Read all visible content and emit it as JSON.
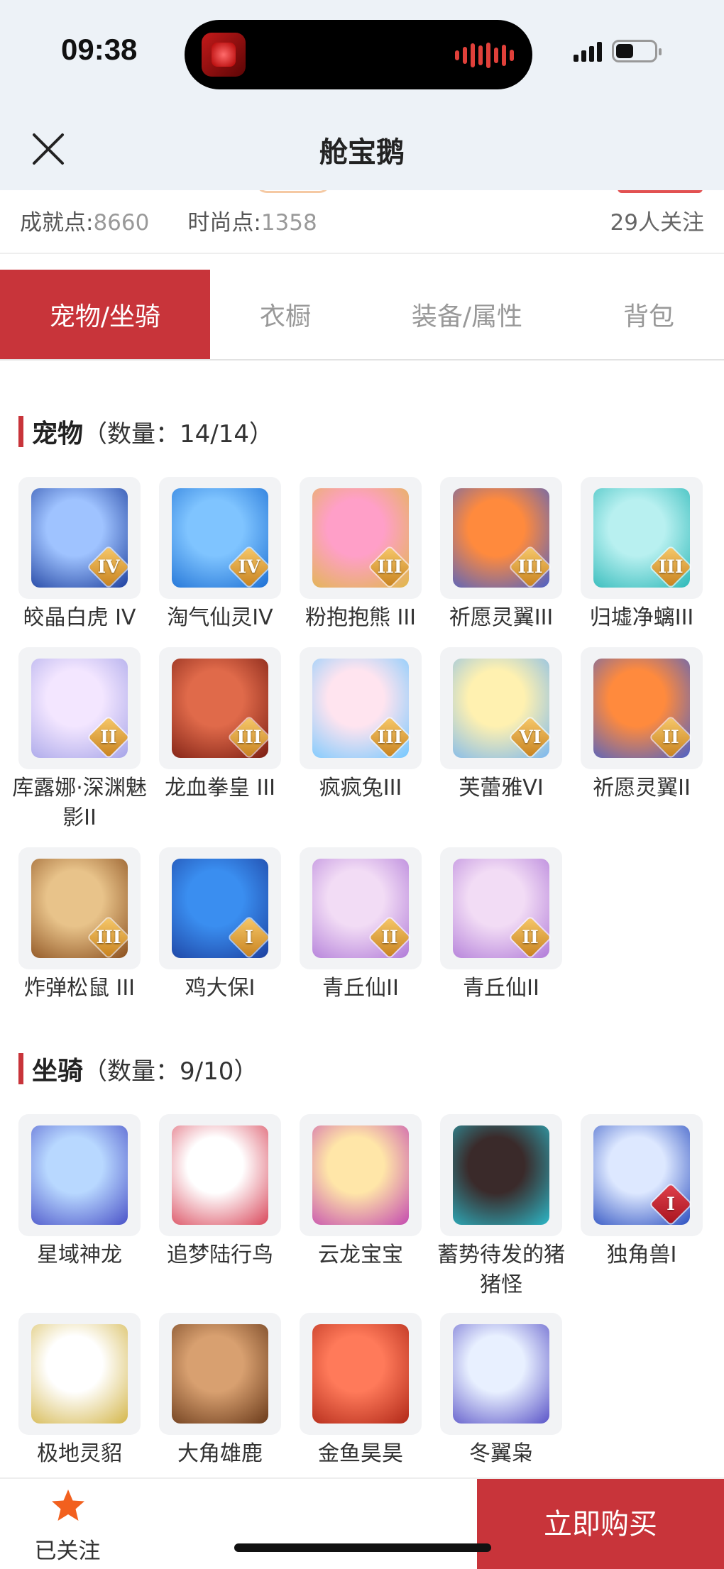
{
  "status_bar": {
    "time": "09:38"
  },
  "nav": {
    "title": "舱宝鹅"
  },
  "info": {
    "achievement_label": "成就点:",
    "achievement_value": "8660",
    "fashion_label": "时尚点:",
    "fashion_value": "1358",
    "followers": "29人关注"
  },
  "tabs": [
    "宠物/坐骑",
    "衣橱",
    "装备/属性",
    "背包"
  ],
  "pets": {
    "title": "宠物",
    "count": "（数量：14/14）",
    "items": [
      {
        "label": "皎晶白虎 IV",
        "badge": "IV",
        "colors": [
          "#9fc3ff",
          "#1d3f9e"
        ]
      },
      {
        "label": "淘气仙灵IV",
        "badge": "IV",
        "colors": [
          "#7fc4ff",
          "#1c6fd4"
        ]
      },
      {
        "label": "粉抱抱熊 III",
        "badge": "III",
        "colors": [
          "#ff9fc8",
          "#e0b84a"
        ]
      },
      {
        "label": "祈愿灵翼III",
        "badge": "III",
        "colors": [
          "#ff8a3d",
          "#4b61c8"
        ]
      },
      {
        "label": "归墟净螭III",
        "badge": "III",
        "colors": [
          "#b8f0f0",
          "#2cb8b8"
        ]
      },
      {
        "label": "库露娜·深渊魅影II",
        "badge": "II",
        "colors": [
          "#f3e6ff",
          "#a6a4e8"
        ]
      },
      {
        "label": "龙血拳皇 III",
        "badge": "III",
        "colors": [
          "#e06a4a",
          "#7a1d12"
        ]
      },
      {
        "label": "疯疯兔III",
        "badge": "III",
        "colors": [
          "#ffe4ef",
          "#74c8ff"
        ]
      },
      {
        "label": "芙蕾雅VI",
        "badge": "VI",
        "colors": [
          "#fff1b0",
          "#7ab7f0"
        ]
      },
      {
        "label": "祈愿灵翼II",
        "badge": "II",
        "colors": [
          "#ff8a3d",
          "#4b61c8"
        ]
      },
      {
        "label": "炸弹松鼠 III",
        "badge": "III",
        "colors": [
          "#e8c38a",
          "#8a4e1d"
        ]
      },
      {
        "label": "鸡大保I",
        "badge": "I",
        "colors": [
          "#3a8ef0",
          "#1c3f9e"
        ]
      },
      {
        "label": "青丘仙II",
        "badge": "II",
        "colors": [
          "#f2dcf5",
          "#b07ad8"
        ]
      },
      {
        "label": "青丘仙II",
        "badge": "II",
        "colors": [
          "#f2dcf5",
          "#b07ad8"
        ]
      }
    ]
  },
  "mounts": {
    "title": "坐骑",
    "count": "（数量：9/10）",
    "items": [
      {
        "label": "星域神龙",
        "badge": "",
        "colors": [
          "#b8d8ff",
          "#4a52c8"
        ]
      },
      {
        "label": "追梦陆行鸟",
        "badge": "",
        "colors": [
          "#ffffff",
          "#d9475a"
        ]
      },
      {
        "label": "云龙宝宝",
        "badge": "",
        "colors": [
          "#ffe6a8",
          "#c44ab0"
        ]
      },
      {
        "label": "蓄势待发的猪猪怪",
        "badge": "",
        "colors": [
          "#3a2a2a",
          "#2cb8c8"
        ]
      },
      {
        "label": "独角兽I",
        "badge": "I",
        "colors": [
          "#dde8ff",
          "#2a4ec0"
        ]
      },
      {
        "label": "极地灵貂",
        "badge": "",
        "colors": [
          "#ffffff",
          "#d4b64a"
        ]
      },
      {
        "label": "大角雄鹿",
        "badge": "",
        "colors": [
          "#d8a070",
          "#6a3a1a"
        ]
      },
      {
        "label": "金鱼昊昊",
        "badge": "",
        "colors": [
          "#ff7a5a",
          "#b02818"
        ]
      },
      {
        "label": "冬翼枭",
        "badge": "",
        "colors": [
          "#e8f0ff",
          "#5a54c8"
        ]
      }
    ]
  },
  "bottom": {
    "follow_label": "已关注",
    "buy_label": "立即购买"
  },
  "colors": {
    "accent": "#c8343a",
    "star": "#f2601e"
  }
}
